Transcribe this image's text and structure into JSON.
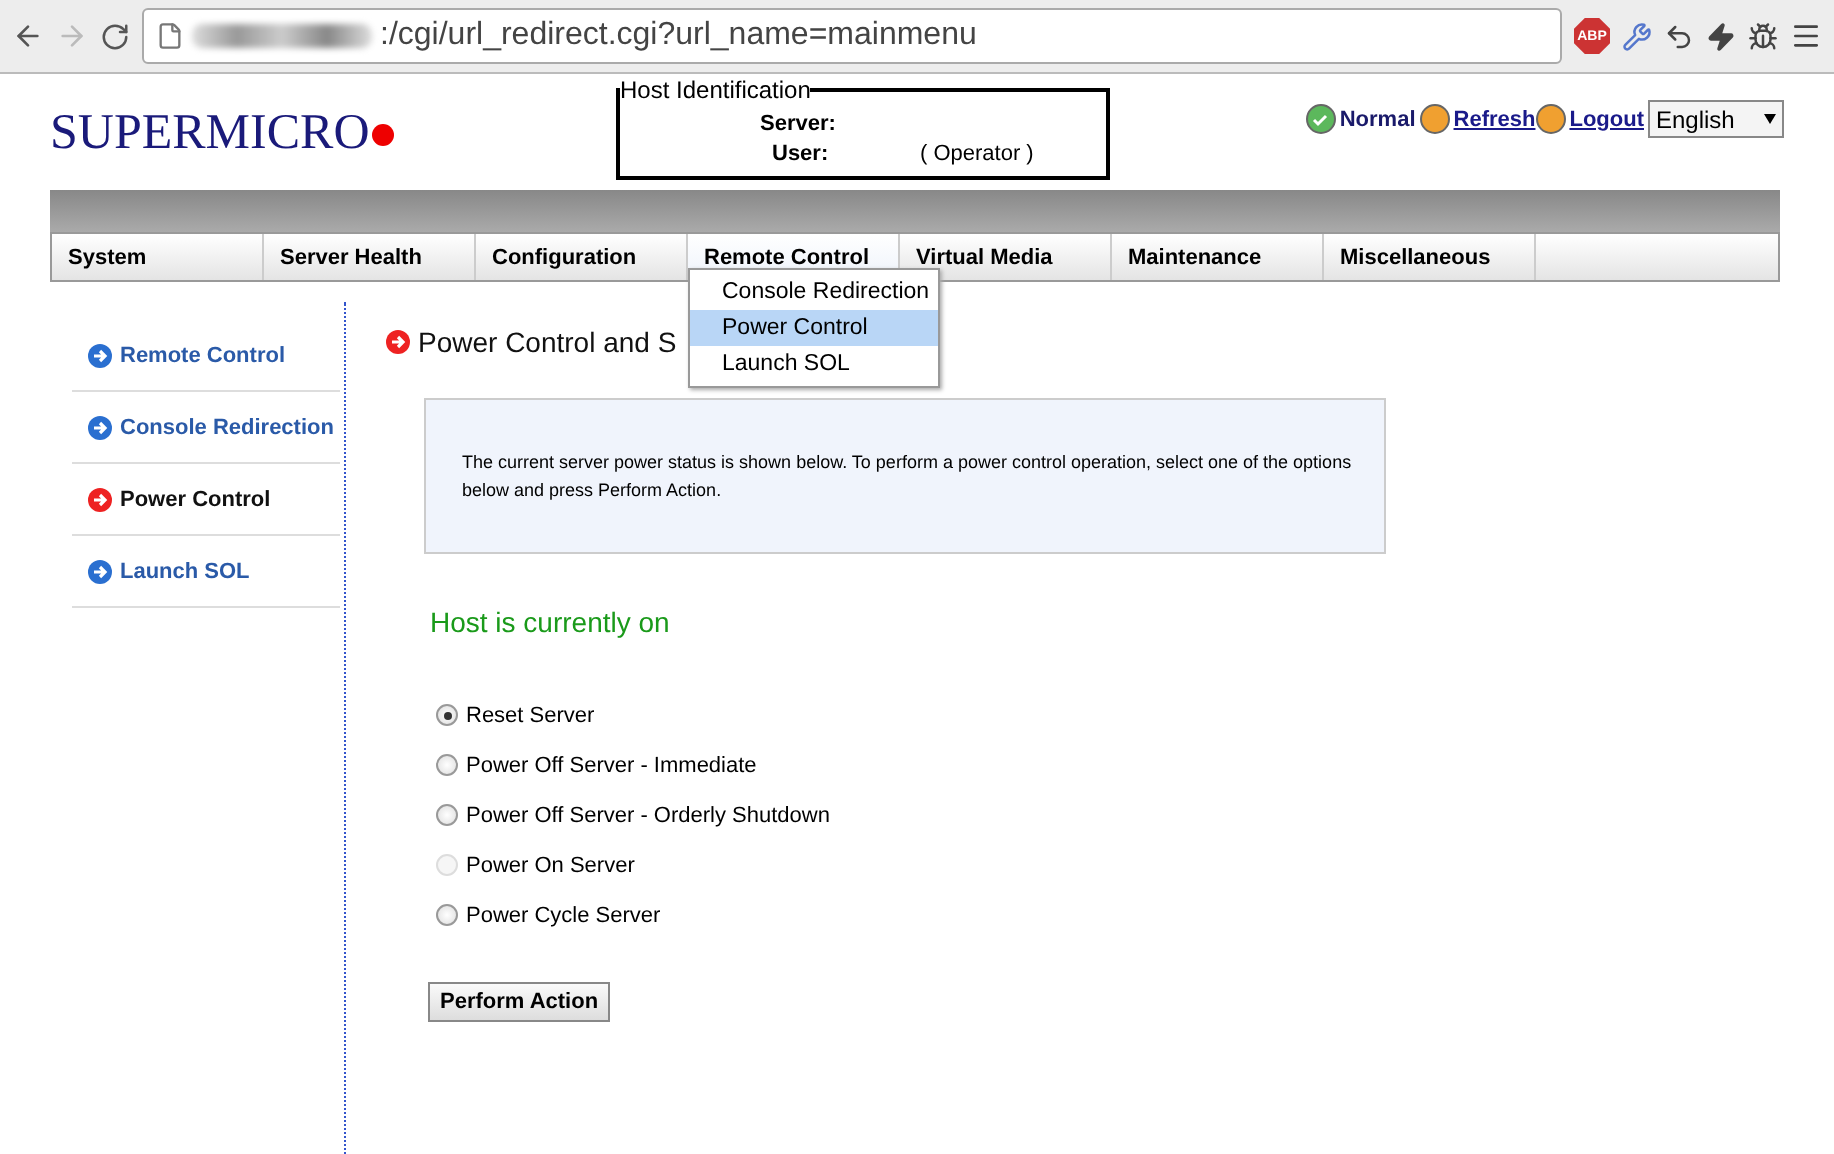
{
  "browser": {
    "url": ":/cgi/url_redirect.cgi?url_name=mainmenu",
    "back_disabled": false,
    "forward_disabled": true,
    "adblock_label": "ABP"
  },
  "header": {
    "logo": "SUPERMICRO",
    "host_identification": {
      "title": "Host Identification",
      "server_label": "Server:",
      "user_label": "User:",
      "role": "( Operator )"
    },
    "status": "Normal",
    "refresh": "Refresh",
    "logout": "Logout",
    "language": "English"
  },
  "nav": [
    {
      "label": "System",
      "selected": false
    },
    {
      "label": "Server Health",
      "selected": false
    },
    {
      "label": "Configuration",
      "selected": false
    },
    {
      "label": "Remote Control",
      "selected": true
    },
    {
      "label": "Virtual Media",
      "selected": false
    },
    {
      "label": "Maintenance",
      "selected": false
    },
    {
      "label": "Miscellaneous",
      "selected": false
    }
  ],
  "dropdown": [
    {
      "label": "Console Redirection",
      "selected": false
    },
    {
      "label": "Power Control",
      "selected": true
    },
    {
      "label": "Launch SOL",
      "selected": false
    }
  ],
  "sidebar": [
    {
      "label": "Remote Control",
      "selected": false
    },
    {
      "label": "Console Redirection",
      "selected": false
    },
    {
      "label": "Power Control",
      "selected": true
    },
    {
      "label": "Launch SOL",
      "selected": false
    }
  ],
  "content": {
    "title": "Power Control and S",
    "info": "The current server power status is shown below. To perform a power control operation, select one of the options below and press Perform Action.",
    "host_status": "Host is currently on",
    "options": [
      {
        "label": "Reset Server",
        "selected": true,
        "disabled": false
      },
      {
        "label": "Power Off Server - Immediate",
        "selected": false,
        "disabled": false
      },
      {
        "label": "Power Off Server - Orderly Shutdown",
        "selected": false,
        "disabled": false
      },
      {
        "label": "Power On Server",
        "selected": false,
        "disabled": true
      },
      {
        "label": "Power Cycle Server",
        "selected": false,
        "disabled": false
      }
    ],
    "action_button": "Perform Action"
  }
}
